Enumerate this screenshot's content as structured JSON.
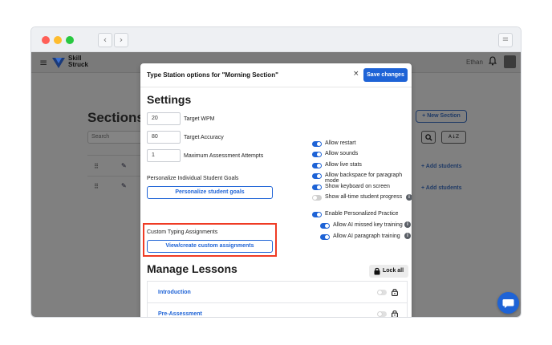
{
  "window": {
    "colors": {
      "close": "#ff5f57",
      "minimize": "#febc2e",
      "maximize": "#28c840"
    },
    "back_glyph": "‹",
    "forward_glyph": "›",
    "menu_glyph": "≡"
  },
  "app_header": {
    "menu_glyph": "≡",
    "logo_line1": "Skill",
    "logo_line2": "Struck",
    "user_name": "Ethan",
    "bell_glyph": "🔔",
    "icons": [
      "hamburger-icon",
      "logo-icon",
      "bell-icon",
      "avatar"
    ]
  },
  "background_page": {
    "title": "Sections",
    "search_placeholder": "Search",
    "new_section_label": "+ New Section",
    "search_icon_glyph": "🔍",
    "az_icon_glyph": "A↓Z",
    "rows": [
      {
        "drag_glyph": "⠿",
        "pencil_glyph": "✎",
        "add_label": "+ Add students"
      },
      {
        "drag_glyph": "⠿",
        "pencil_glyph": "✎",
        "add_label": "+ Add students"
      }
    ]
  },
  "modal": {
    "title": "Type Station options for \"Morning Section\"",
    "close_glyph": "×",
    "save_label": "Save changes",
    "settings_heading": "Settings",
    "inputs": [
      {
        "value": "20",
        "label": "Target WPM"
      },
      {
        "value": "80",
        "label": "Target Accuracy"
      },
      {
        "value": "1",
        "label": "Maximum Assessment Attempts"
      }
    ],
    "personalize_label": "Personalize Individual Student Goals",
    "personalize_button": "Personalize student goals",
    "custom_label": "Custom Typing Assignments",
    "custom_button": "View/create custom assignments",
    "highlight_color": "#ef3b24",
    "toggles": [
      {
        "label": "Allow restart",
        "on": true
      },
      {
        "label": "Allow sounds",
        "on": true
      },
      {
        "label": "Allow live stats",
        "on": true
      },
      {
        "label": "Allow backspace for paragraph mode",
        "on": true
      },
      {
        "label": "Show keyboard on screen",
        "on": true
      },
      {
        "label": "Show all-time student progress",
        "on": false,
        "info": true
      }
    ],
    "personalized_practice": {
      "label": "Enable Personalized Practice",
      "on": true
    },
    "sub_toggles": [
      {
        "label": "Allow AI missed key training",
        "on": true,
        "info": true
      },
      {
        "label": "Allow AI paragraph training",
        "on": true,
        "info": true
      }
    ],
    "info_glyph": "i",
    "lessons_heading": "Manage Lessons",
    "lock_all_label": "Lock all",
    "lessons": [
      {
        "name": "Introduction"
      },
      {
        "name": "Pre-Assessment"
      }
    ]
  },
  "accent_color": "#1e63d6"
}
